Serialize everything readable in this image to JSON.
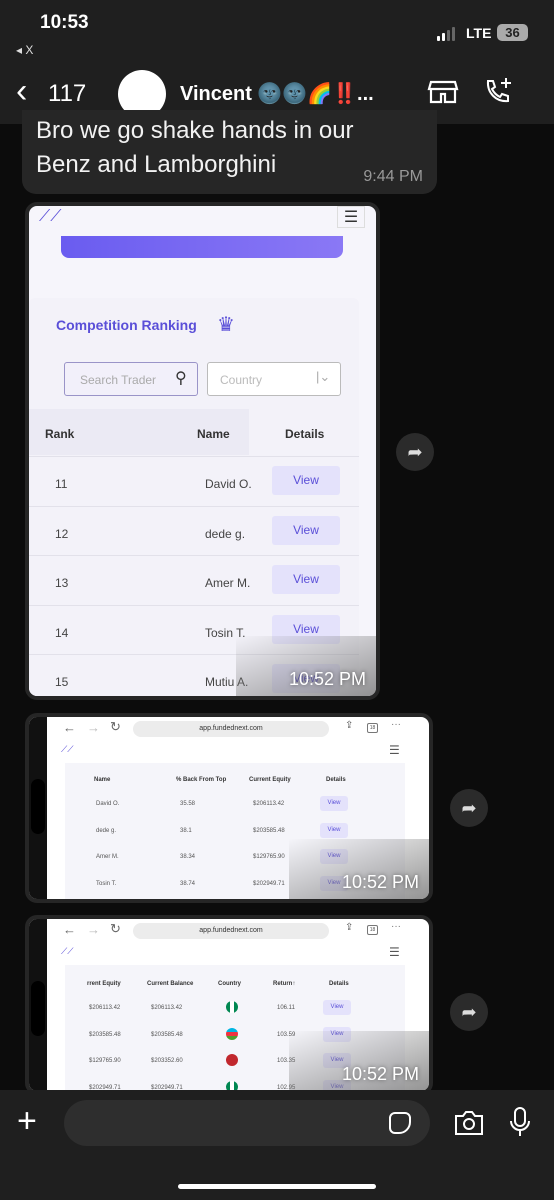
{
  "status": {
    "time": "10:53",
    "back_app": "◂ X",
    "network": "LTE",
    "battery": "36"
  },
  "header": {
    "back_count": "117",
    "contact_name": "Vincent 🌚🌚🌈‼️..."
  },
  "messages": {
    "text": {
      "lines": [
        "Bro we go shake hands in our",
        "Benz and Lamborghini"
      ],
      "time": "9:44 PM"
    },
    "image1": {
      "title": "Competition Ranking",
      "search_placeholder": "Search Trader",
      "country_placeholder": "Country",
      "headers": [
        "Rank",
        "Name",
        "Details"
      ],
      "rows": [
        [
          "11",
          "David O.",
          "View"
        ],
        [
          "12",
          "dede g.",
          "View"
        ],
        [
          "13",
          "Amer M.",
          "View"
        ],
        [
          "14",
          "Tosin T.",
          "View"
        ],
        [
          "15",
          "Mutiu A.",
          "View"
        ]
      ],
      "time": "10:52 PM"
    },
    "image2": {
      "url": "app.fundednext.com",
      "tabs": "18",
      "headers": [
        "Name",
        "% Back From Top",
        "Current Equity",
        "Details"
      ],
      "rows": [
        [
          "David O.",
          "35.58",
          "$206113.42",
          "View"
        ],
        [
          "dede g.",
          "38.1",
          "$203585.48",
          "View"
        ],
        [
          "Amer M.",
          "38.34",
          "$129765.90",
          "View"
        ],
        [
          "Tosin T.",
          "38.74",
          "$202949.71",
          "View"
        ]
      ],
      "time": "10:52 PM"
    },
    "image3": {
      "url": "app.fundednext.com",
      "tabs": "18",
      "headers": [
        "rrent Equity",
        "Current Balance",
        "Country",
        "Return↑",
        "Details"
      ],
      "rows": [
        [
          "$206113.42",
          "$206113.42",
          "nigeria",
          "106.11",
          "View"
        ],
        [
          "$203585.48",
          "$203585.48",
          "azerbaijan",
          "103.59",
          "View"
        ],
        [
          "$129765.90",
          "$203352.60",
          "morocco",
          "103.35",
          "View"
        ],
        [
          "$202949.71",
          "$202949.71",
          "nigeria",
          "102.95",
          "View"
        ]
      ],
      "time": "10:52 PM"
    }
  },
  "colors": {
    "accent": "#5a4fd8",
    "bubble": "#262626",
    "bar": "#1f1f1f"
  }
}
